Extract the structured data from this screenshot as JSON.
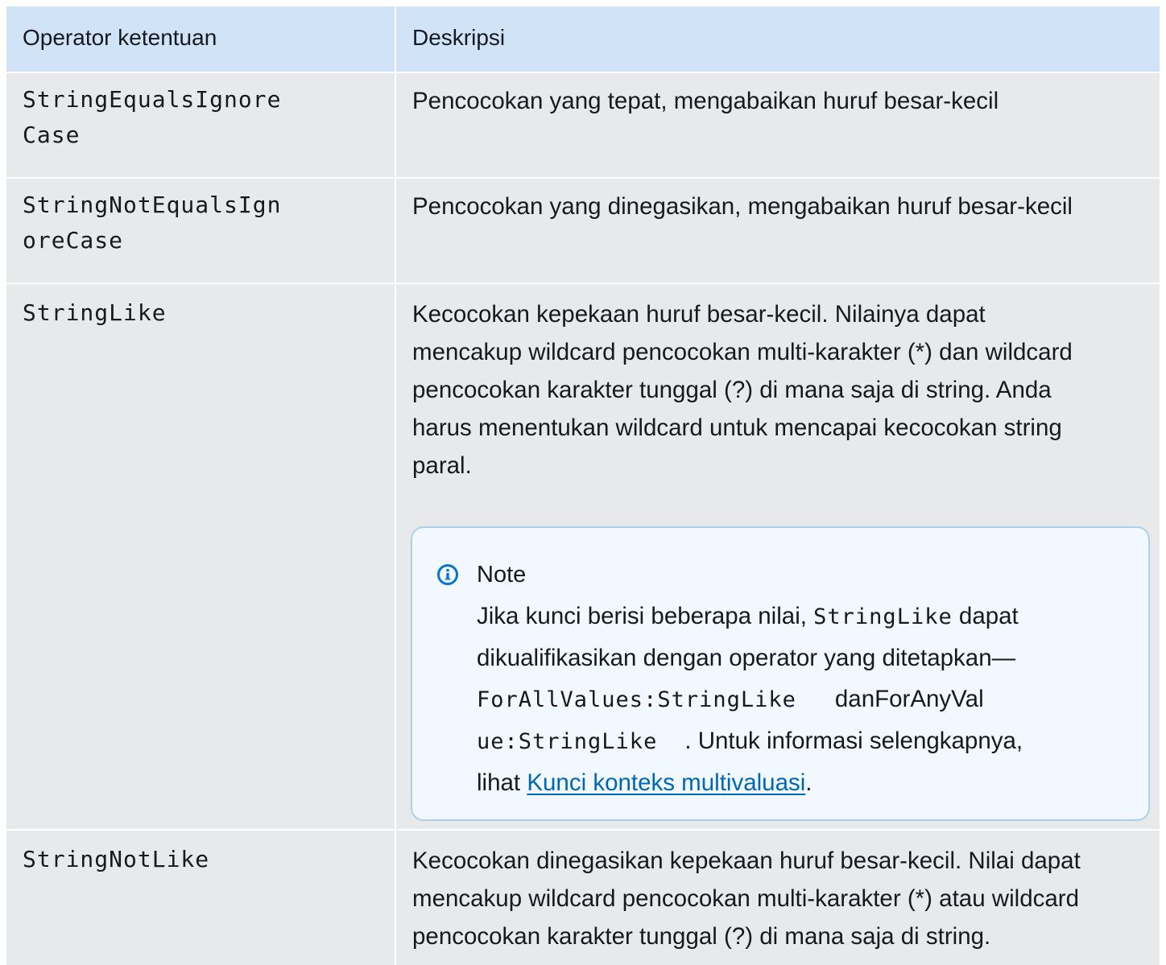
{
  "table": {
    "headers": [
      "Operator ketentuan",
      "Deskripsi"
    ],
    "rows": [
      {
        "operator_line1": "StringEqualsIgnore",
        "operator_line2": "Case",
        "description": "Pencocokan yang tepat, mengabaikan huruf besar-kecil"
      },
      {
        "operator_line1": "StringNotEqualsIgn",
        "operator_line2": "oreCase",
        "description": "Pencocokan yang dinegasikan, mengabaikan huruf besar-kecil"
      },
      {
        "operator_line1": "StringLike",
        "description_lines": [
          "Kecocokan kepekaan huruf besar-kecil. Nilainya dapat",
          "mencakup wildcard pencocokan multi-karakter (*) dan wildcard",
          "pencocokan karakter tunggal (?) di mana saja di string. Anda",
          "harus menentukan wildcard untuk mencapai kecocokan string",
          "paral."
        ],
        "note": {
          "icon": "info-icon",
          "title": "Note",
          "line1_text": "Jika kunci berisi beberapa nilai,",
          "line1_code": "StringLike",
          "line1_after": " dapat",
          "line2_text": "dikualifikasikan dengan operator yang ditetapkan—",
          "line3_code": "ForAllValues:StringLike",
          "line3_text": "danForAnyVal",
          "line4_code": "ue:StringLike",
          "line4_text": ". Untuk informasi selengkapnya,",
          "line5_text": "lihat ",
          "link_text": "Kunci konteks multivaluasi",
          "line5_after": "."
        }
      },
      {
        "operator_line1": "StringNotLike",
        "description_lines": [
          "Kecocokan dinegasikan kepekaan huruf besar-kecil. Nilai dapat",
          "mencakup wildcard pencocokan multi-karakter (*) atau wildcard",
          "pencocokan karakter tunggal (?) di mana saja di string."
        ]
      }
    ]
  },
  "colors": {
    "header_bg": "#d1e4f7",
    "row_bg": "#e8e9eb",
    "note_bg": "#f1f8ff",
    "note_border": "#aed0ee",
    "link": "#0066b6"
  }
}
